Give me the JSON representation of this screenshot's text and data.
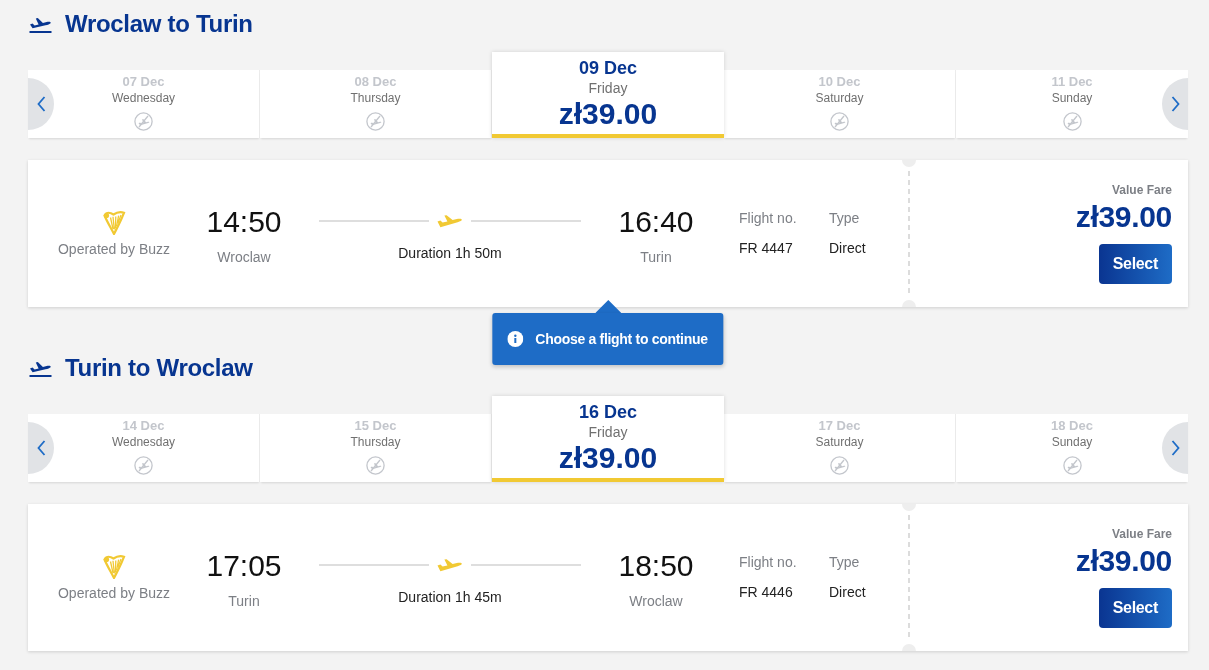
{
  "journeys": [
    {
      "title": "Wroclaw to Turin",
      "dates": [
        {
          "date": "07 Dec",
          "day": "Wednesday",
          "selected": false
        },
        {
          "date": "08 Dec",
          "day": "Thursday",
          "selected": false
        },
        {
          "date": "09 Dec",
          "day": "Friday",
          "price": "zł39.00",
          "selected": true
        },
        {
          "date": "10 Dec",
          "day": "Saturday",
          "selected": false
        },
        {
          "date": "11 Dec",
          "day": "Sunday",
          "selected": false
        }
      ],
      "flights": [
        {
          "operator": "Operated by Buzz",
          "departure_time": "14:50",
          "origin": "Wroclaw",
          "duration": "Duration 1h 50m",
          "arrival_time": "16:40",
          "destination": "Turin",
          "flight_no_label": "Flight no.",
          "flight_no": "FR 4447",
          "type_label": "Type",
          "type": "Direct",
          "fare_name": "Value Fare",
          "fare_price": "zł39.00",
          "button": "Select"
        }
      ],
      "tooltip": "Choose a flight to continue"
    },
    {
      "title": "Turin to Wroclaw",
      "dates": [
        {
          "date": "14 Dec",
          "day": "Wednesday",
          "selected": false
        },
        {
          "date": "15 Dec",
          "day": "Thursday",
          "selected": false
        },
        {
          "date": "16 Dec",
          "day": "Friday",
          "price": "zł39.00",
          "selected": true
        },
        {
          "date": "17 Dec",
          "day": "Saturday",
          "selected": false
        },
        {
          "date": "18 Dec",
          "day": "Sunday",
          "selected": false
        }
      ],
      "flights": [
        {
          "operator": "Operated by Buzz",
          "departure_time": "17:05",
          "origin": "Turin",
          "duration": "Duration 1h 45m",
          "arrival_time": "18:50",
          "destination": "Wroclaw",
          "flight_no_label": "Flight no.",
          "flight_no": "FR 4446",
          "type_label": "Type",
          "type": "Direct",
          "fare_name": "Value Fare",
          "fare_price": "zł39.00",
          "button": "Select"
        }
      ]
    }
  ]
}
